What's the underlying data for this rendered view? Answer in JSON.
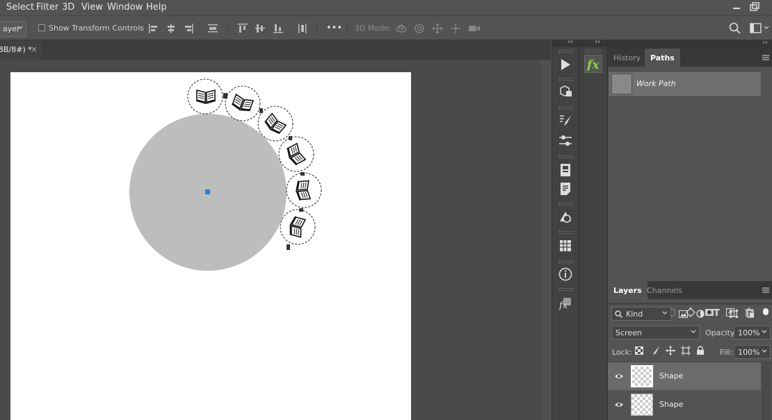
{
  "menu": {
    "items": [
      "Select",
      "Filter",
      "3D",
      "View",
      "Window",
      "Help"
    ]
  },
  "options": {
    "layer_dropdown": "ayer",
    "show_transform_controls": "Show Transform Controls",
    "more": "•••",
    "mode_3d": "3D Mode:"
  },
  "document": {
    "tab_title": "8B/8#) *",
    "close": "×",
    "circle_color": "#bdbdbd",
    "anchor_color": "#1e7fe0"
  },
  "collapse": {
    "left": "‹‹",
    "right": "››"
  },
  "paths_panel": {
    "tabs": [
      "History",
      "Paths"
    ],
    "active_tab": "Paths",
    "work_path": "Work Path"
  },
  "layers_panel": {
    "tabs": [
      "Layers",
      "Channels"
    ],
    "active_tab": "Layers",
    "filter_kind": "Kind",
    "blend_mode": "Screen",
    "opacity_label": "Opacity:",
    "opacity_value": "100%",
    "lock_label": "Lock:",
    "fill_label": "Fill:",
    "fill_value": "100%",
    "layers": [
      {
        "name": "Shape",
        "selected": true
      },
      {
        "name": "Shape",
        "selected": false
      }
    ]
  },
  "icons": {
    "canvas_symbol": "open-book-icon"
  }
}
